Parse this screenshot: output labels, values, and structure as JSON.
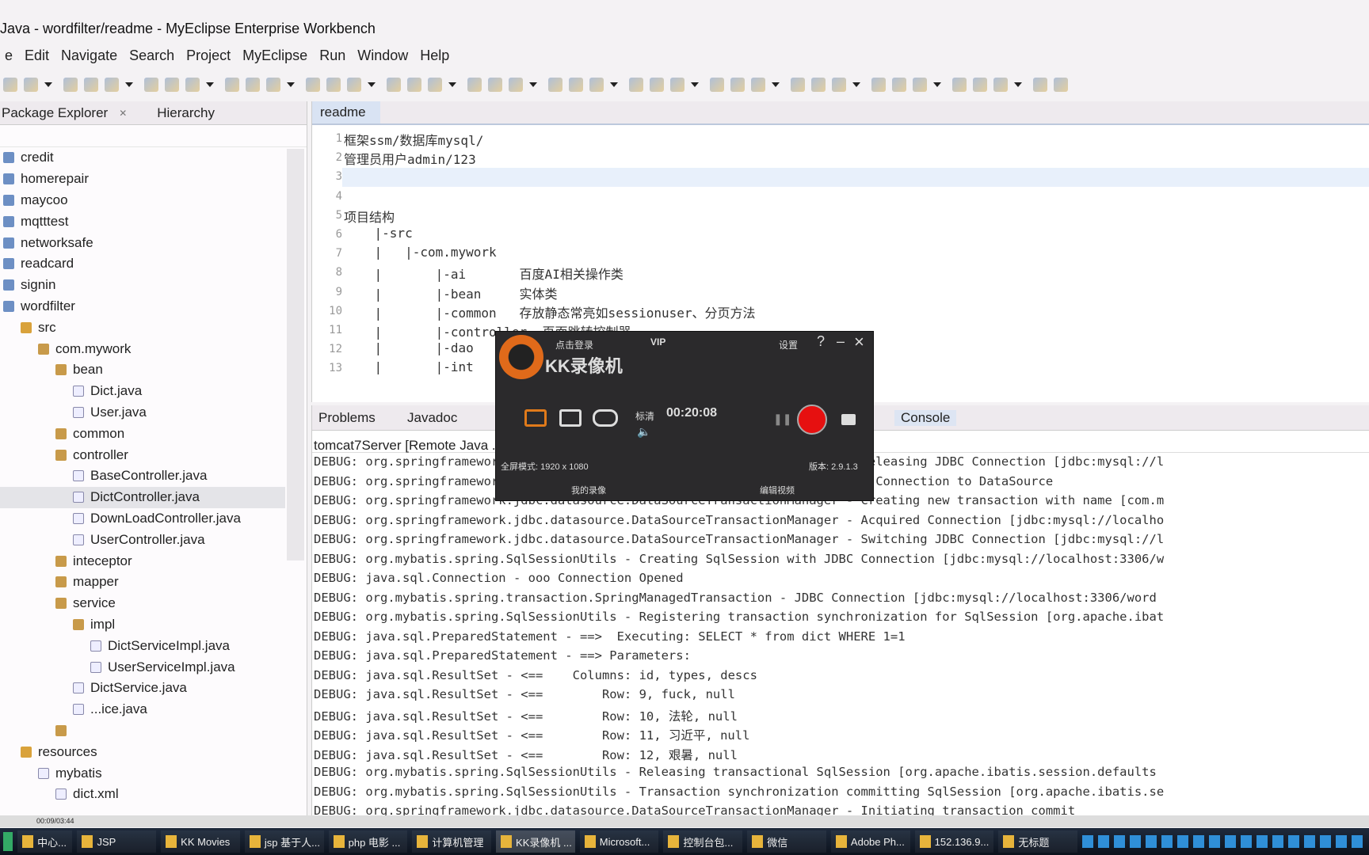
{
  "window": {
    "title": "Java - wordfilter/readme - MyEclipse Enterprise Workbench"
  },
  "menu": [
    "e",
    "Edit",
    "Navigate",
    "Search",
    "Project",
    "MyEclipse",
    "Run",
    "Window",
    "Help"
  ],
  "left_panel": {
    "tabs": [
      "Package Explorer",
      "Hierarchy"
    ],
    "tree": [
      {
        "label": "credit",
        "level": 0,
        "icon": "project-icon"
      },
      {
        "label": "homerepair",
        "level": 0,
        "icon": "project-icon"
      },
      {
        "label": "maycoo",
        "level": 0,
        "icon": "project-icon"
      },
      {
        "label": "mqtttest",
        "level": 0,
        "icon": "project-icon"
      },
      {
        "label": "networksafe",
        "level": 0,
        "icon": "project-icon"
      },
      {
        "label": "readcard",
        "level": 0,
        "icon": "project-icon"
      },
      {
        "label": "signin",
        "level": 0,
        "icon": "project-icon"
      },
      {
        "label": "wordfilter",
        "level": 0,
        "icon": "project-icon"
      },
      {
        "label": "src",
        "level": 1,
        "icon": "source-folder-icon"
      },
      {
        "label": "com.mywork",
        "level": 2,
        "icon": "package-icon"
      },
      {
        "label": "bean",
        "level": 3,
        "icon": "package-icon"
      },
      {
        "label": "Dict.java",
        "level": 4,
        "icon": "java-file-icon"
      },
      {
        "label": "User.java",
        "level": 4,
        "icon": "java-file-icon"
      },
      {
        "label": "common",
        "level": 3,
        "icon": "package-icon"
      },
      {
        "label": "controller",
        "level": 3,
        "icon": "package-icon"
      },
      {
        "label": "BaseController.java",
        "level": 4,
        "icon": "java-file-icon"
      },
      {
        "label": "DictController.java",
        "level": 4,
        "icon": "java-file-icon",
        "selected": true
      },
      {
        "label": "DownLoadController.java",
        "level": 4,
        "icon": "java-file-icon"
      },
      {
        "label": "UserController.java",
        "level": 4,
        "icon": "java-file-icon"
      },
      {
        "label": "inteceptor",
        "level": 3,
        "icon": "package-icon"
      },
      {
        "label": "mapper",
        "level": 3,
        "icon": "package-icon"
      },
      {
        "label": "service",
        "level": 3,
        "icon": "package-icon"
      },
      {
        "label": "impl",
        "level": 4,
        "icon": "package-icon"
      },
      {
        "label": "DictServiceImpl.java",
        "level": 5,
        "icon": "java-file-icon"
      },
      {
        "label": "UserServiceImpl.java",
        "level": 5,
        "icon": "java-file-icon"
      },
      {
        "label": "DictService.java",
        "level": 4,
        "icon": "java-file-icon"
      },
      {
        "label": "...ice.java",
        "level": 4,
        "icon": "java-file-icon"
      },
      {
        "label": "",
        "level": 3,
        "icon": "package-icon"
      },
      {
        "label": "resources",
        "level": 1,
        "icon": "source-folder-icon"
      },
      {
        "label": "mybatis",
        "level": 2,
        "icon": "folder-icon"
      },
      {
        "label": "dict.xml",
        "level": 3,
        "icon": "xml-file-icon"
      }
    ]
  },
  "editor": {
    "tab": "readme",
    "lines": [
      "框架ssm/数据库mysql/",
      "管理员用户admin/123",
      "",
      "",
      "项目结构",
      "    |-src",
      "    |   |-com.mywork",
      "    |       |-ai       百度AI相关操作类",
      "    |       |-bean     实体类",
      "    |       |-common   存放静态常亮如sessionuser、分页方法",
      "    |       |-controller  页面跳转控制器",
      "    |       |-dao",
      "    |       |-int"
    ]
  },
  "bottom_panel": {
    "tabs": [
      "Problems",
      "Javadoc",
      "Console"
    ],
    "header": "tomcat7Server [Remote Java ... 2020-3-2 下午11:56:44)",
    "console": [
      "DEBUG: org.springframework.jdbc.datasource.DataSourceTransactionManager - Releasing JDBC Connection [jdbc:mysql://l",
      "DEBUG: org.springframework.jdbc.datasource.DataSourceUtils - Returning JDBC Connection to DataSource",
      "DEBUG: org.springframework.jdbc.datasource.DataSourceTransactionManager - Creating new transaction with name [com.m",
      "DEBUG: org.springframework.jdbc.datasource.DataSourceTransactionManager - Acquired Connection [jdbc:mysql://localho",
      "DEBUG: org.springframework.jdbc.datasource.DataSourceTransactionManager - Switching JDBC Connection [jdbc:mysql://l",
      "DEBUG: org.mybatis.spring.SqlSessionUtils - Creating SqlSession with JDBC Connection [jdbc:mysql://localhost:3306/w",
      "DEBUG: java.sql.Connection - ooo Connection Opened",
      "DEBUG: org.mybatis.spring.transaction.SpringManagedTransaction - JDBC Connection [jdbc:mysql://localhost:3306/word",
      "DEBUG: org.mybatis.spring.SqlSessionUtils - Registering transaction synchronization for SqlSession [org.apache.ibat",
      "DEBUG: java.sql.PreparedStatement - ==>  Executing: SELECT * from dict WHERE 1=1",
      "DEBUG: java.sql.PreparedStatement - ==> Parameters: ",
      "DEBUG: java.sql.ResultSet - <==    Columns: id, types, descs",
      "DEBUG: java.sql.ResultSet - <==        Row: 9, fuck, null",
      "DEBUG: java.sql.ResultSet - <==        Row: 10, 法轮, null",
      "DEBUG: java.sql.ResultSet - <==        Row: 11, 习近平, null",
      "DEBUG: java.sql.ResultSet - <==        Row: 12, 艰暑, null",
      "DEBUG: org.mybatis.spring.SqlSessionUtils - Releasing transactional SqlSession [org.apache.ibatis.session.defaults",
      "DEBUG: org.mybatis.spring.SqlSessionUtils - Transaction synchronization committing SqlSession [org.apache.ibatis.se",
      "DEBUG: org.springframework.jdbc.datasource.DataSourceTransactionManager - Initiating transaction commit"
    ]
  },
  "status": {
    "time": "00:09/03:44"
  },
  "kk": {
    "login": "点击登录",
    "vip": "VIP",
    "settings": "设置",
    "help": "?",
    "minimize": "–",
    "close": "×",
    "name": "KK录像机",
    "quality": "标清",
    "timer": "00:20:08",
    "mode": "全屏模式: 1920 x 1080",
    "version": "版本: 2.9.1.3",
    "my_videos": "我的录像",
    "edit_video": "编辑视频",
    "record_color": "#e61010"
  },
  "taskbar": [
    "中心...",
    "JSP",
    "KK Movies",
    "jsp 基于人...",
    "php 电影 ...",
    "计算机管理",
    "KK录像机 ...",
    "Microsoft...",
    "控制台包...",
    "微信",
    "Adobe Ph...",
    "152.136.9...",
    "无标题"
  ]
}
